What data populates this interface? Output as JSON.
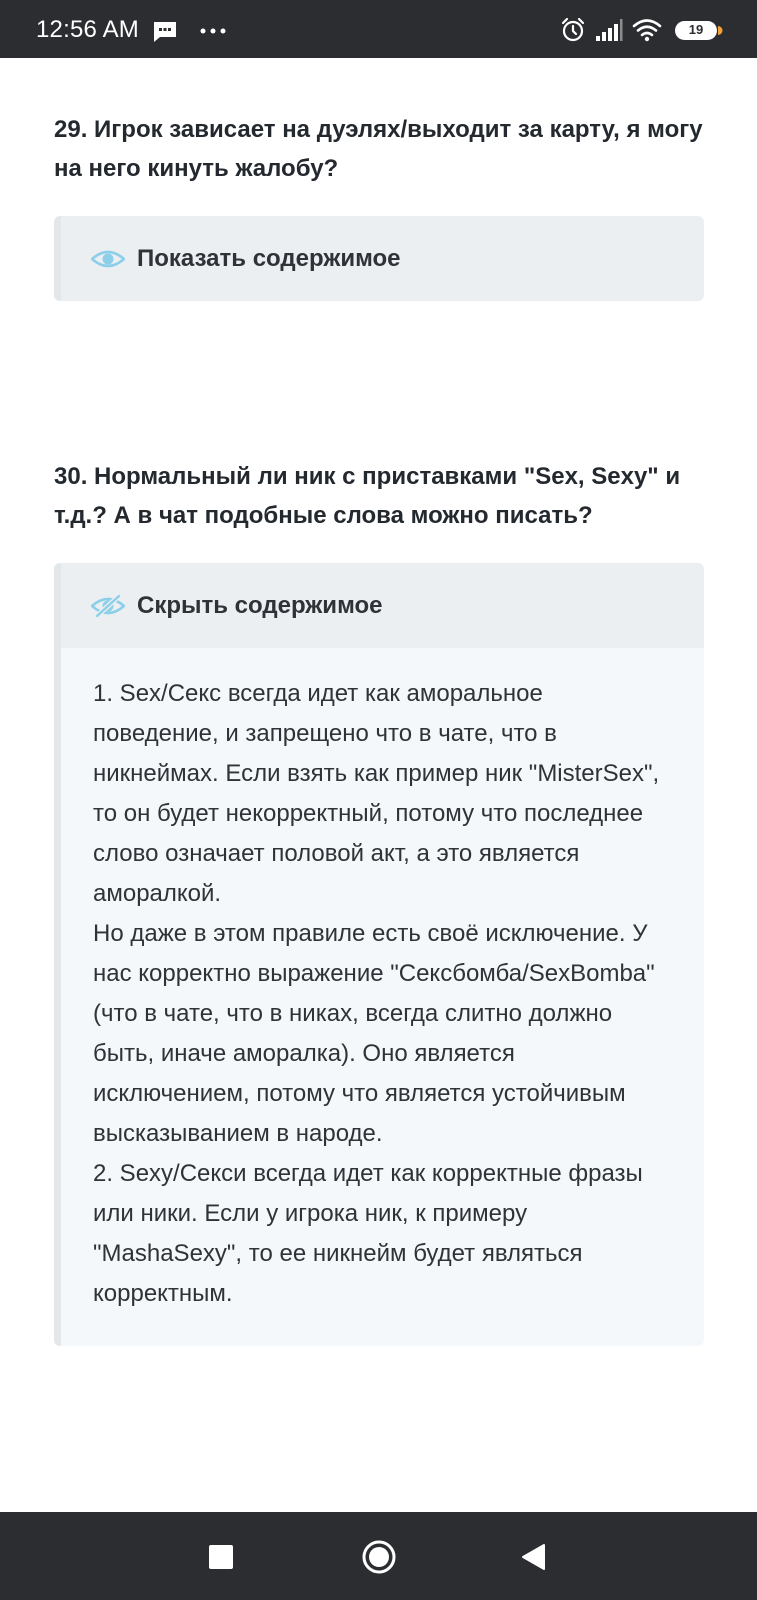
{
  "status_bar": {
    "time": "12:56 AM",
    "battery_level": "19",
    "icons": [
      "message-icon",
      "more-dots-icon",
      "alarm-icon",
      "signal-icon",
      "wifi-icon",
      "battery-icon"
    ]
  },
  "faq": [
    {
      "question": "29. Игрок зависает на дуэлях/выходит за карту, я могу на него кинуть жалобу?",
      "toggle_label": "Показать содержимое",
      "expanded": false,
      "icon": "eye-icon"
    },
    {
      "question": "30. Нормальный ли ник с приставками \"Sex, Sexy\" и т.д.? А в чат подобные слова можно писать?",
      "toggle_label": "Скрыть содержимое",
      "expanded": true,
      "icon": "eye-slash-icon",
      "content": [
        "1. Sex/Секс всегда идет как аморальное поведение, и запрещено что в чате, что в никнеймах. Если взять как пример ник \"MisterSex\", то он будет некорректный, потому что последнее слово означает половой акт, а это является аморалкой.",
        "Но даже в этом правиле есть своё исключение. У нас корректно выражение \"Сексбомба/SexBomba\" (что в чате, что в никах, всегда слитно должно быть, иначе аморалка). Оно является исключением, потому что является устойчивым высказыванием в народе.",
        "2. Sexy/Секси всегда идет как корректные фразы или ники. Если у игрока ник, к примеру \"MashaSexy\", то ее никнейм будет являться корректным."
      ]
    }
  ],
  "nav_bar": {
    "buttons": [
      "recents-button",
      "home-button",
      "back-button"
    ]
  },
  "colors": {
    "bars": "#2b2d31",
    "spoiler_bg": "#f5f8fa",
    "spoiler_header_bg": "#ebeff2",
    "eye_icon": "#8ccfe8"
  }
}
